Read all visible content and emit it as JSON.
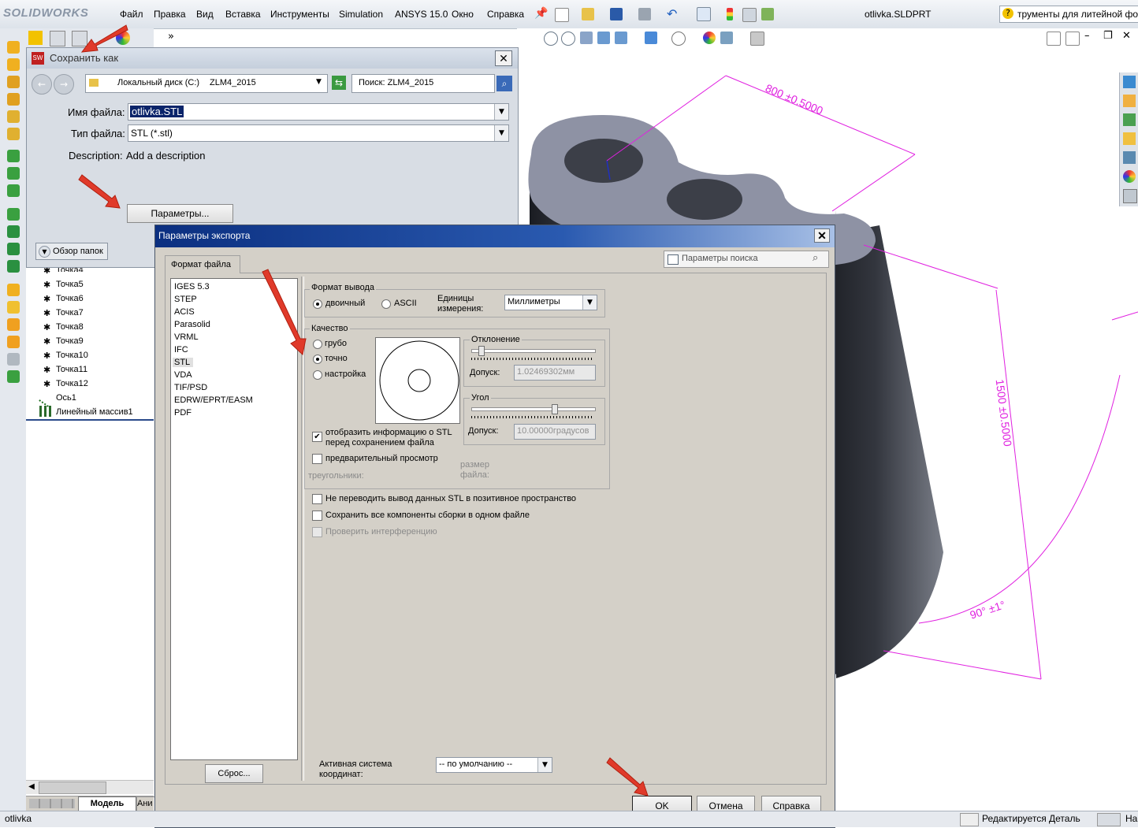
{
  "app": {
    "logo": "SOLIDWORKS",
    "doc_title": "otlivka.SLDPRT",
    "search_hint": "трументы для литейной фо"
  },
  "menu": [
    "Файл",
    "Правка",
    "Вид",
    "Вставка",
    "Инструменты",
    "Simulation",
    "ANSYS 15.0",
    "Окно",
    "Справка"
  ],
  "tree": {
    "items": [
      "Точка4",
      "Точка5",
      "Точка6",
      "Точка7",
      "Точка8",
      "Точка9",
      "Точка10",
      "Точка11",
      "Точка12",
      "Ось1",
      "Линейный массив1"
    ],
    "tabs": [
      "Модель",
      "Ани"
    ]
  },
  "save_dialog": {
    "title": "Сохранить как",
    "location": "Локальный диск (C:)",
    "folder": "ZLM4_2015",
    "search": "Поиск: ZLM4_2015",
    "filename_label": "Имя файла:",
    "filename": "otlivka.STL",
    "filetype_label": "Тип файла:",
    "filetype": "STL (*.stl)",
    "description_label": "Description:",
    "description": "Add a description",
    "options_button": "Параметры...",
    "browse_button": "Обзор папок"
  },
  "export_dialog": {
    "title": "Параметры экспорта",
    "tab": "Формат файла",
    "search_placeholder": "Параметры поиска",
    "formats": [
      "IGES 5.3",
      "STEP",
      "ACIS",
      "Parasolid",
      "VRML",
      "IFC",
      "STL",
      "VDA",
      "TIF/PSD",
      "EDRW/EPRT/EASM",
      "PDF"
    ],
    "selected_format": "STL",
    "reset_button": "Сброс...",
    "output_format_label": "Формат вывода",
    "binary_label": "двоичный",
    "ascii_label": "ASCII",
    "units_label": "Единицы измерения:",
    "units_value": "Миллиметры",
    "quality_label": "Качество",
    "coarse_label": "грубо",
    "fine_label": "точно",
    "custom_label": "настройка",
    "quality_selected": "точно",
    "deviation_label": "Отклонение",
    "deviation_tol_label": "Допуск:",
    "deviation_value": "1.02469302мм",
    "angle_label": "Угол",
    "angle_tol_label": "Допуск:",
    "angle_value": "10.00000градусов",
    "show_info_label": "отобразить информацию о STL перед сохранением файла",
    "show_info_checked": true,
    "preview_label": "предварительный просмотр",
    "triangles_label": "треугольники:",
    "filesize_label": "размер файла:",
    "no_translate_label": "Не переводить вывод данных STL в позитивное пространство",
    "save_all_label": "Сохранить все компоненты сборки в одном файле",
    "check_interf_label": "Проверить интерференцию",
    "coord_label": "Активная система координат:",
    "coord_value": "-- по умолчанию --",
    "ok": "OK",
    "cancel": "Отмена",
    "help": "Справка"
  },
  "dimensions": {
    "d1": "800 ±0.5000",
    "d2": "1500 ±0.5000",
    "d3": "90° ±1°"
  },
  "status": {
    "left": "otlivka",
    "right": "Редактируется Деталь",
    "extra": "На"
  },
  "colors": {
    "accent_magenta": "#e020e0",
    "title_blue": "#0b2f80",
    "arrow_red": "#e03a2a"
  }
}
